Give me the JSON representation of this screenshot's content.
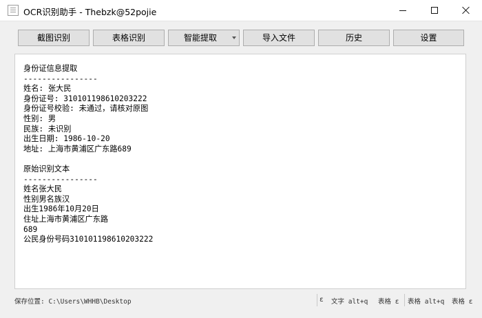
{
  "window": {
    "title": "OCR识别助手 - Thebzk@52pojie"
  },
  "toolbar": {
    "buttons": [
      {
        "label": "截图识别"
      },
      {
        "label": "表格识别"
      },
      {
        "label": "智能提取",
        "has_dropdown": true
      },
      {
        "label": "导入文件"
      },
      {
        "label": "历史"
      },
      {
        "label": "设置"
      }
    ]
  },
  "content": {
    "lines": [
      "身份证信息提取",
      "----------------",
      "姓名: 张大民",
      "身份证号: 310101198610203222",
      "身份证号校验: 未通过，请核对原图",
      "性别: 男",
      "民族: 未识别",
      "出生日期: 1986-10-20",
      "地址: 上海市黄浦区广东路689",
      "",
      "原始识别文本",
      "----------------",
      "姓名张大民",
      "性别男名族汉",
      "出生1986年10月20日",
      "住址上海市黄浦区广东路",
      "689",
      "公民身份号码310101198610203222"
    ]
  },
  "statusbar": {
    "save_location": "保存位置: C:\\Users\\WHHB\\Desktop",
    "hotkeys": [
      "ε",
      "文字 alt+q",
      "表格 ε",
      "表格 alt+q",
      "表格 ε"
    ]
  }
}
